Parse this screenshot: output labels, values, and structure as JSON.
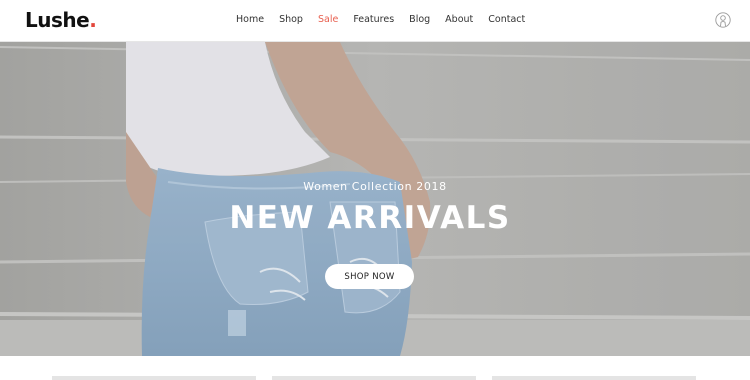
{
  "brand": {
    "name": "Lushe",
    "dot": "."
  },
  "nav": {
    "items": [
      {
        "label": "Home",
        "active": false
      },
      {
        "label": "Shop",
        "active": false
      },
      {
        "label": "Sale",
        "active": true
      },
      {
        "label": "Features",
        "active": false
      },
      {
        "label": "Blog",
        "active": false
      },
      {
        "label": "About",
        "active": false
      },
      {
        "label": "Contact",
        "active": false
      }
    ]
  },
  "header": {
    "account_icon": "user-icon"
  },
  "hero": {
    "subtitle": "Women Collection 2018",
    "title": "NEW ARRIVALS",
    "cta": "SHOP NOW"
  },
  "colors": {
    "accent": "#e86050",
    "logo_dot": "#e3463b",
    "text": "#333333",
    "hero_text": "#ffffff"
  }
}
